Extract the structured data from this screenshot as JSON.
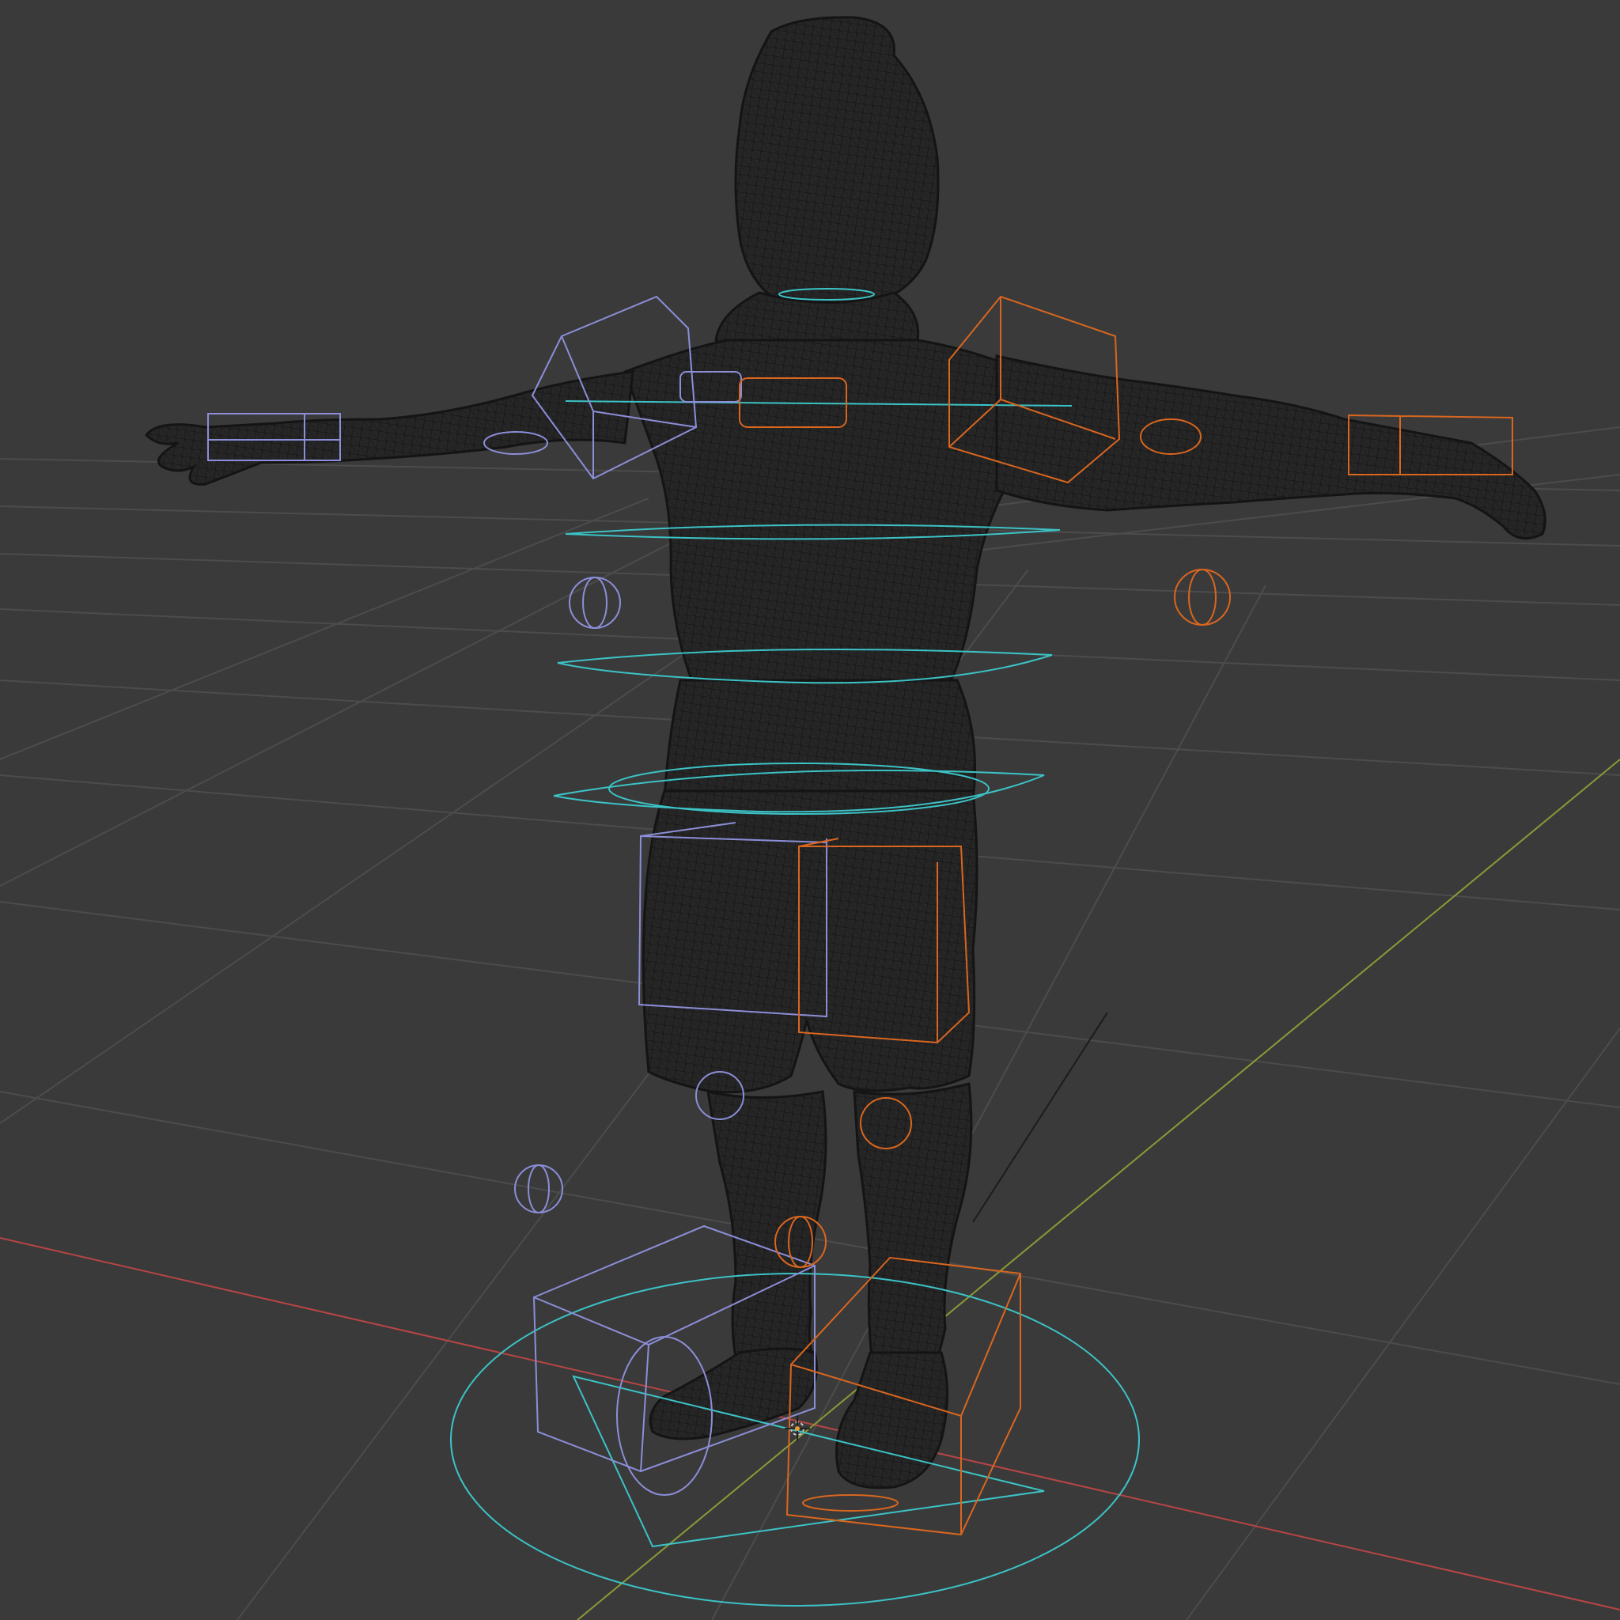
{
  "viewport": {
    "background_color": "#3a3a3a",
    "grid_color": "#4c4c4c",
    "x_axis_color": "#b84545",
    "y_axis_color": "#8a9a36",
    "mesh_wire_color": "#141414",
    "mesh_fill_color": "#262626",
    "left_controls_color": "#8c8ed8",
    "right_controls_color": "#d9661f",
    "center_controls_color": "#3cc3c6",
    "origin_icon": "3d-cursor-icon",
    "subject": "wireframe-character-rig"
  }
}
